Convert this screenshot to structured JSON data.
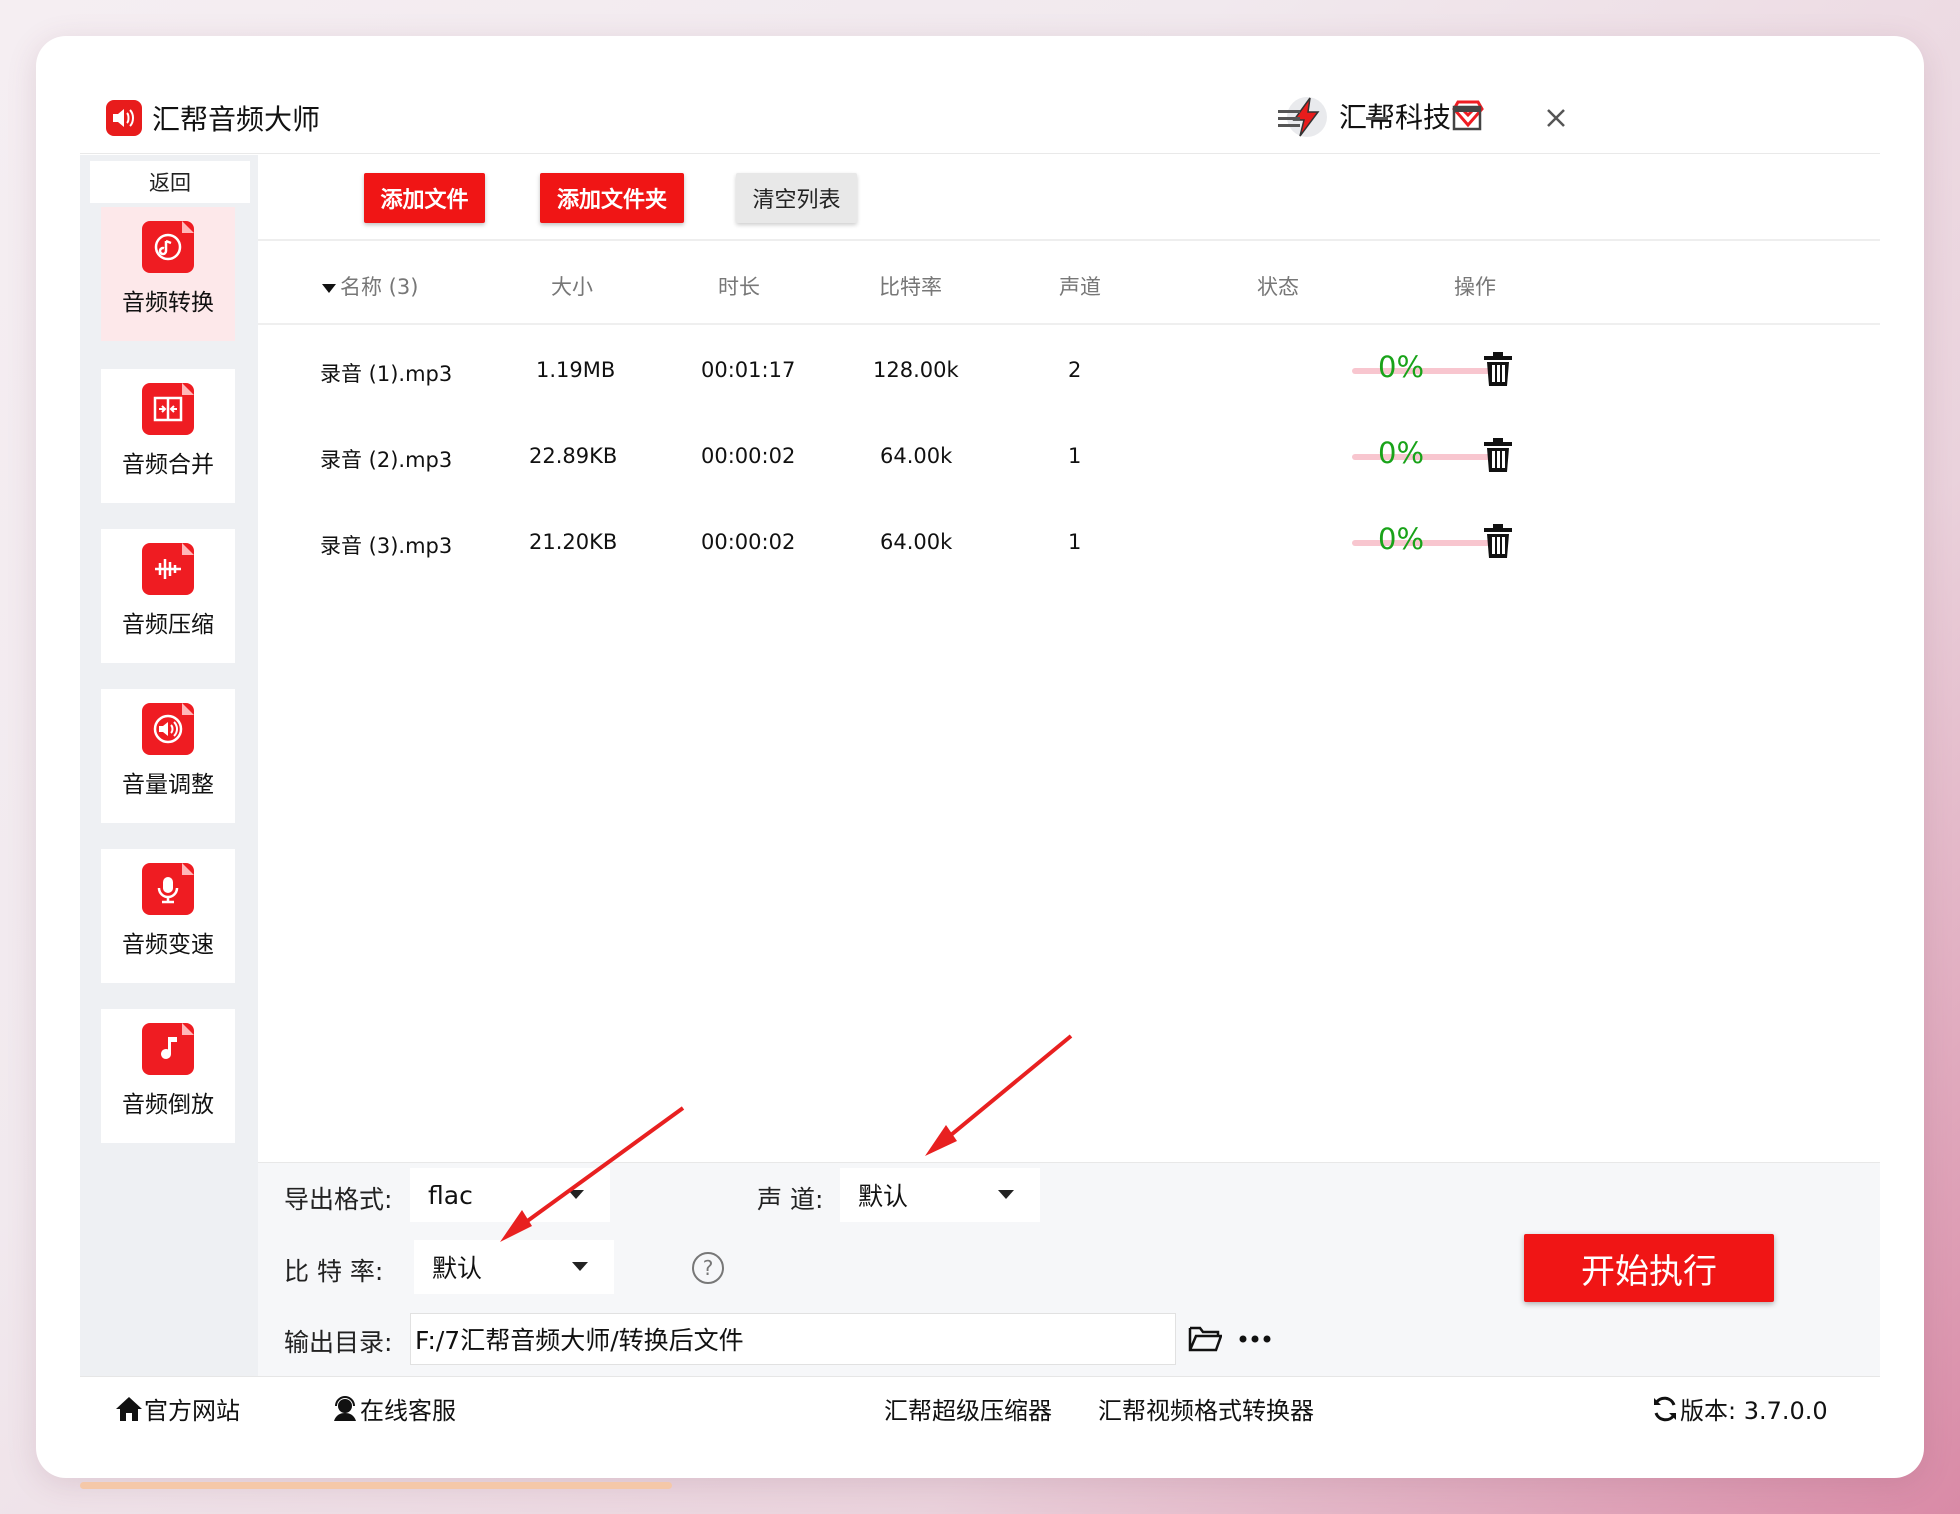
{
  "app": {
    "title": "汇帮音频大师",
    "brand": "汇帮科技",
    "back_label": "返回"
  },
  "colors": {
    "accent": "#f01515",
    "success": "#19a319",
    "active_bg": "#fde8ea",
    "progress_track": "#f8c6cf"
  },
  "sidebar": {
    "items": [
      {
        "label": "音频转换",
        "icon": "audio-convert-icon",
        "active": true
      },
      {
        "label": "音频合并",
        "icon": "audio-merge-icon",
        "active": false
      },
      {
        "label": "音频压缩",
        "icon": "audio-compress-icon",
        "active": false
      },
      {
        "label": "音量调整",
        "icon": "volume-icon",
        "active": false
      },
      {
        "label": "音频变速",
        "icon": "microphone-icon",
        "active": false
      },
      {
        "label": "音频倒放",
        "icon": "music-note-icon",
        "active": false
      }
    ]
  },
  "toolbar": {
    "add_file": "添加文件",
    "add_folder": "添加文件夹",
    "clear_list": "清空列表"
  },
  "table": {
    "headers": {
      "name": "名称 (3)",
      "size": "大小",
      "duration": "时长",
      "bitrate": "比特率",
      "channel": "声道",
      "status": "状态",
      "action": "操作"
    },
    "rows": [
      {
        "name": "录音 (1).mp3",
        "size": "1.19MB",
        "duration": "00:01:17",
        "bitrate": "128.00k",
        "channel": "2",
        "progress": 0,
        "pct": "0%"
      },
      {
        "name": "录音 (2).mp3",
        "size": "22.89KB",
        "duration": "00:00:02",
        "bitrate": "64.00k",
        "channel": "1",
        "progress": 0,
        "pct": "0%"
      },
      {
        "name": "录音 (3).mp3",
        "size": "21.20KB",
        "duration": "00:00:02",
        "bitrate": "64.00k",
        "channel": "1",
        "progress": 0,
        "pct": "0%"
      }
    ]
  },
  "settings": {
    "format_label": "导出格式:",
    "format_value": "flac",
    "channel_label": "声 道:",
    "channel_value": "默认",
    "bitrate_label": "比 特 率:",
    "bitrate_value": "默认",
    "output_label": "输出目录:",
    "output_value": "F:/7汇帮音频大师/转换后文件",
    "start_label": "开始执行"
  },
  "footer": {
    "website": "官方网站",
    "support": "在线客服",
    "compressor": "汇帮超级压缩器",
    "video_converter": "汇帮视频格式转换器",
    "version": "版本: 3.7.0.0"
  }
}
